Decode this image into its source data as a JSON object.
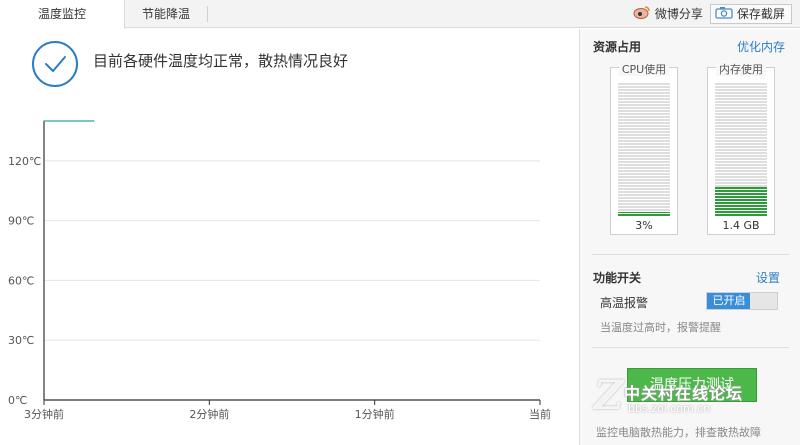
{
  "tabs": [
    {
      "label": "温度监控",
      "active": true
    },
    {
      "label": "节能降温",
      "active": false
    }
  ],
  "toolbar": {
    "weibo_share": "微博分享",
    "save_screenshot": "保存截屏"
  },
  "status": {
    "message": "目前各硬件温度均正常，散热情况良好"
  },
  "chart_data": {
    "type": "line",
    "x_ticks": [
      "3分钟前",
      "2分钟前",
      "1分钟前",
      "当前"
    ],
    "y_ticks": [
      "0℃",
      "30℃",
      "60℃",
      "90℃",
      "120℃"
    ],
    "ylim": [
      0,
      140
    ],
    "grid": true,
    "series": [
      {
        "x": [
          0,
          0.3
        ],
        "values": [
          140,
          140
        ],
        "color": "#2ea89a"
      }
    ]
  },
  "resources": {
    "title": "资源占用",
    "optimize_link": "优化内存",
    "cpu": {
      "label": "CPU使用",
      "value": "3%",
      "fraction": 0.03
    },
    "memory": {
      "label": "内存使用",
      "value": "1.4 GB",
      "fraction": 0.22
    }
  },
  "features": {
    "title": "功能开关",
    "settings_link": "设置",
    "high_temp_alarm": {
      "label": "高温报警",
      "state": "已开启",
      "hint": "当温度过高时，报警提醒"
    }
  },
  "stress_test": {
    "button": "温度压力测试",
    "hint": "监控电脑散热能力，排查散热故障"
  },
  "watermark": {
    "logo_letter": "Z",
    "name": "中关村在线论坛",
    "url": "bbs.zol.com.cn"
  },
  "colors": {
    "accent": "#2b7cc7",
    "meter_fill": "#2e9b3a",
    "toggle_on": "#3a8ed8",
    "button_green": "#4cb84a"
  }
}
